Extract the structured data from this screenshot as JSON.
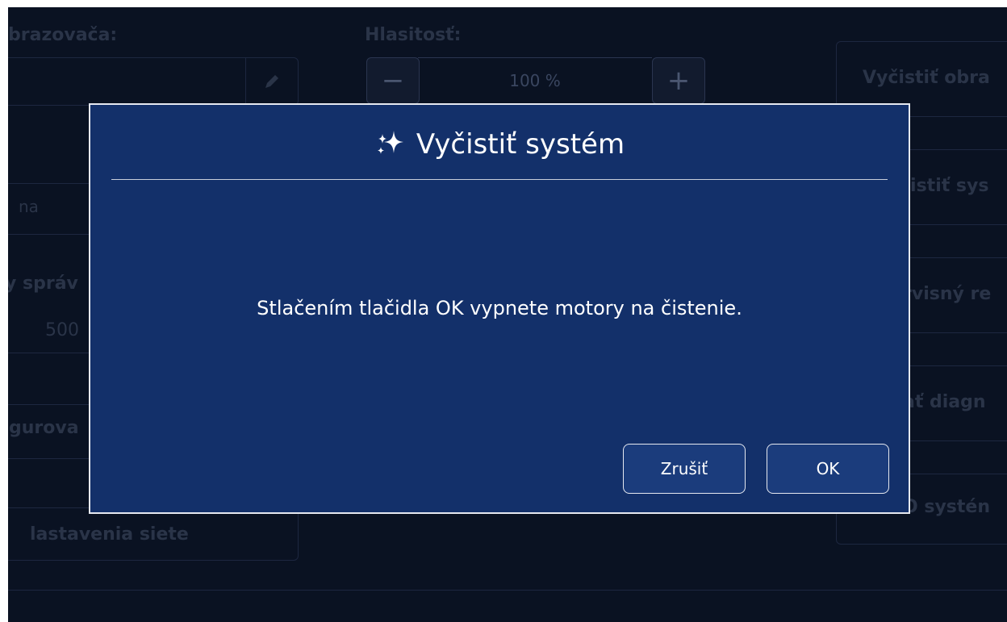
{
  "background": {
    "display_label_fragment": "brazovača:",
    "volume_label": "Hlasitosť:",
    "volume_value": "100 %",
    "field_text_fragment": "na",
    "messages_label_fragment": "y správ",
    "messages_value_fragment": "500",
    "configure_fragment": "gurova",
    "network_settings_fragment": "lastavenia siete",
    "right_buttons": [
      "Vyčistiť obra",
      "čistiť sys",
      "rvisný re",
      "ať diagn",
      "O systén"
    ]
  },
  "dialog": {
    "title": "Vyčistiť systém",
    "message": "Stlačením tlačidla OK vypnete motory na čistenie.",
    "cancel_label": "Zrušiť",
    "ok_label": "OK"
  },
  "colors": {
    "screen_bg": "#0a1222",
    "dialog_bg": "#13306a",
    "button_bg": "#1b3c7c",
    "border": "#e6e9f0"
  }
}
